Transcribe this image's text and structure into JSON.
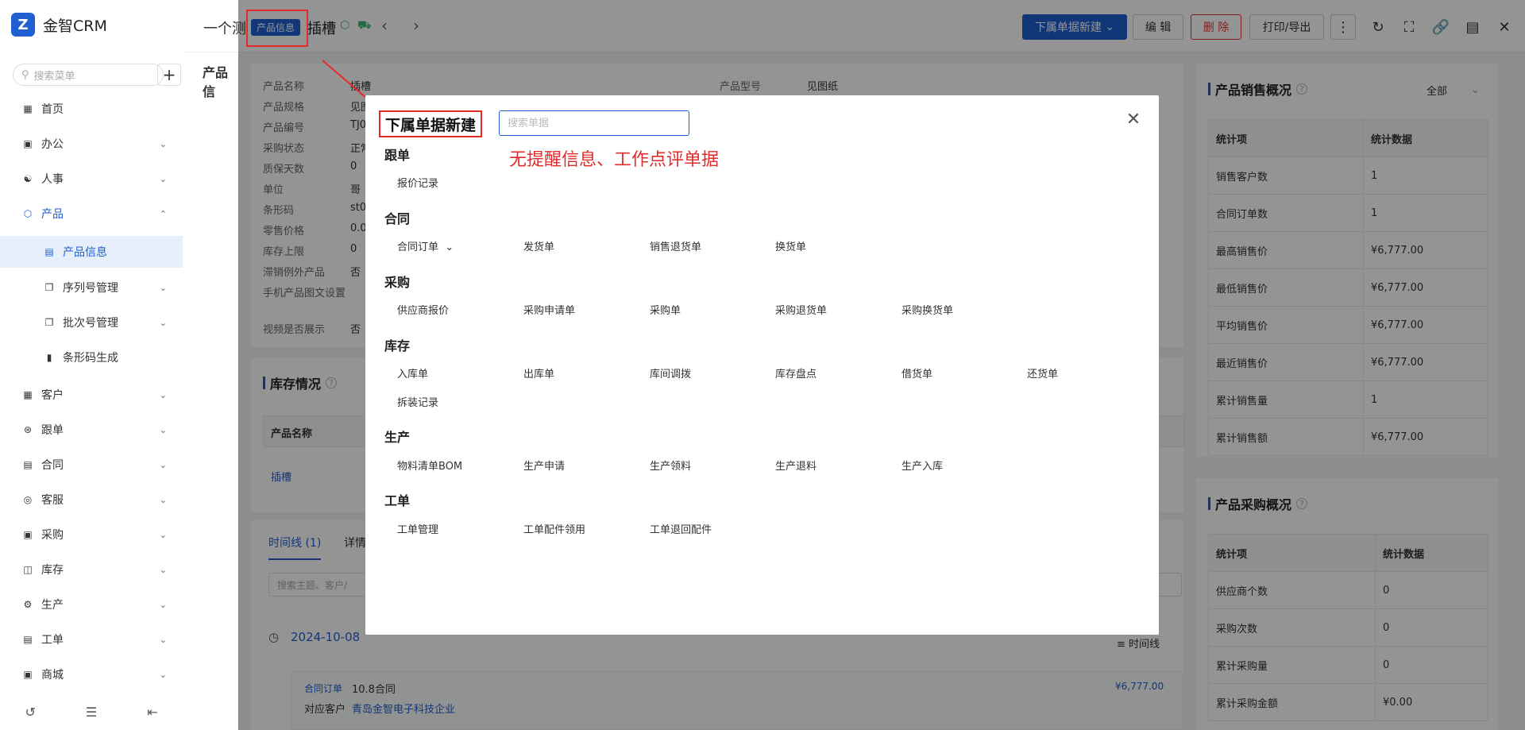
{
  "app": {
    "logo_text": "金智CRM",
    "search_placeholder": "搜索菜单"
  },
  "sidebar": {
    "items": [
      {
        "label": "首页",
        "icon": "dashboard-icon"
      },
      {
        "label": "办公",
        "icon": "office-icon"
      },
      {
        "label": "人事",
        "icon": "people-icon"
      },
      {
        "label": "产品",
        "icon": "product-icon"
      },
      {
        "label": "产品信息",
        "icon": "list-icon"
      },
      {
        "label": "序列号管理",
        "icon": "copy-icon"
      },
      {
        "label": "批次号管理",
        "icon": "copy-icon"
      },
      {
        "label": "条形码生成",
        "icon": "barcode-icon"
      },
      {
        "label": "客户",
        "icon": "customer-icon"
      },
      {
        "label": "跟单",
        "icon": "follow-icon"
      },
      {
        "label": "合同",
        "icon": "contract-icon"
      },
      {
        "label": "客服",
        "icon": "headset-icon"
      },
      {
        "label": "采购",
        "icon": "purchase-icon"
      },
      {
        "label": "库存",
        "icon": "stock-icon"
      },
      {
        "label": "生产",
        "icon": "production-icon"
      },
      {
        "label": "工单",
        "icon": "workorder-icon"
      },
      {
        "label": "商城",
        "icon": "shop-icon"
      }
    ]
  },
  "topbar": {
    "title_prefix": "一个测",
    "tag": "产品信息",
    "title": "插槽",
    "new_sub_btn": "下属单据新建",
    "edit_btn": "编 辑",
    "delete_btn": "删 除",
    "print_btn": "打印/导出"
  },
  "product_info": {
    "rows": [
      {
        "label": "产品名称",
        "value": "插槽"
      },
      {
        "label": "产品规格",
        "value": "见图"
      },
      {
        "label": "产品编号",
        "value": "TJ0"
      },
      {
        "label": "采购状态",
        "value": "正常"
      },
      {
        "label": "质保天数",
        "value": "0"
      },
      {
        "label": "单位",
        "value": "哥"
      },
      {
        "label": "条形码",
        "value": "st0"
      },
      {
        "label": "零售价格",
        "value": "0.0"
      },
      {
        "label": "库存上限",
        "value": "0"
      },
      {
        "label": "滞销例外产品",
        "value": "否"
      },
      {
        "label": "手机产品图文设置",
        "value": ""
      },
      {
        "label": "视频是否展示",
        "value": "否"
      }
    ],
    "model_label": "产品型号",
    "model_value": "见图纸"
  },
  "left_panel_title": "产品信",
  "stock": {
    "title": "库存情况",
    "col_name": "产品名称",
    "row_name": "插槽"
  },
  "timeline": {
    "tab1": "时间线 (1)",
    "tab2": "详情",
    "search_placeholder": "搜索主题、客户/",
    "date": "2024-10-08",
    "view_label": "时间线",
    "entry_type": "合同订单",
    "entry_title": "10.8合同",
    "entry_amount": "¥6,777.00",
    "customer_label": "对应客户",
    "customer_name": "青岛金智电子科技企业"
  },
  "sales_overview": {
    "title": "产品销售概况",
    "filter": "全部",
    "header": [
      "统计项",
      "统计数据"
    ],
    "rows": [
      [
        "销售客户数",
        "1"
      ],
      [
        "合同订单数",
        "1"
      ],
      [
        "最高销售价",
        "¥6,777.00"
      ],
      [
        "最低销售价",
        "¥6,777.00"
      ],
      [
        "平均销售价",
        "¥6,777.00"
      ],
      [
        "最近销售价",
        "¥6,777.00"
      ],
      [
        "累计销售量",
        "1"
      ],
      [
        "累计销售额",
        "¥6,777.00"
      ]
    ]
  },
  "purchase_overview": {
    "title": "产品采购概况",
    "header": [
      "统计项",
      "统计数据"
    ],
    "rows": [
      [
        "供应商个数",
        "0"
      ],
      [
        "采购次数",
        "0"
      ],
      [
        "累计采购量",
        "0"
      ],
      [
        "累计采购金额",
        "¥0.00"
      ]
    ]
  },
  "modal": {
    "title": "下属单据新建",
    "search_placeholder": "搜索单据",
    "note": "无提醒信息、工作点评单据",
    "groups": [
      {
        "name": "跟单",
        "items": [
          "报价记录"
        ]
      },
      {
        "name": "合同",
        "items": [
          "合同订单",
          "发货单",
          "销售退货单",
          "换货单"
        ]
      },
      {
        "name": "采购",
        "items": [
          "供应商报价",
          "采购申请单",
          "采购单",
          "采购退货单",
          "采购换货单"
        ]
      },
      {
        "name": "库存",
        "items": [
          "入库单",
          "出库单",
          "库间调拨",
          "库存盘点",
          "借货单",
          "还货单",
          "拆装记录"
        ]
      },
      {
        "name": "生产",
        "items": [
          "物料清单BOM",
          "生产申请",
          "生产领料",
          "生产退料",
          "生产入库"
        ]
      },
      {
        "name": "工单",
        "items": [
          "工单管理",
          "工单配件领用",
          "工单退回配件"
        ]
      }
    ]
  },
  "colors": {
    "accent": "#1f5fd1",
    "danger": "#e32b2b"
  }
}
